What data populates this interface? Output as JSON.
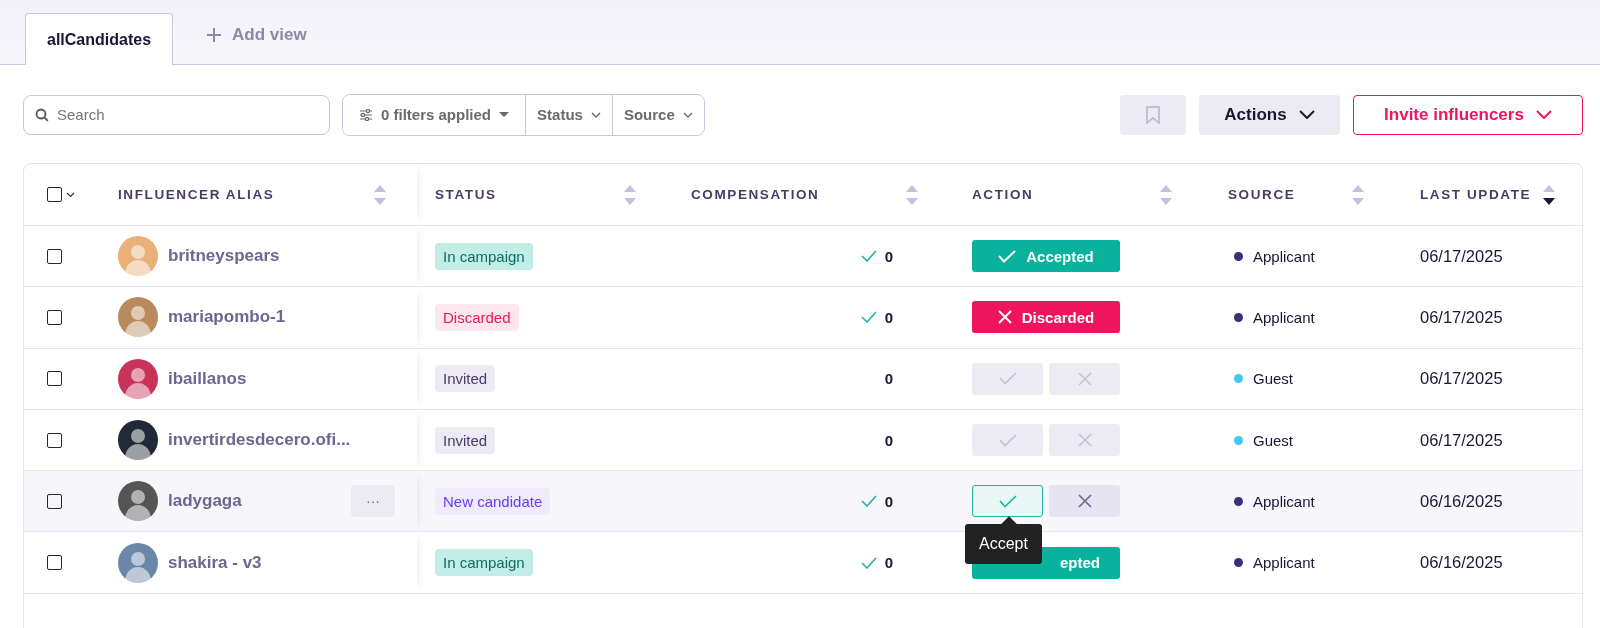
{
  "tabs": [
    {
      "label": "allCandidates",
      "selected": true
    },
    {
      "label": "Add view",
      "selected": false,
      "kind": "add"
    }
  ],
  "toolbar": {
    "search": {
      "placeholder": "Search"
    },
    "filters": {
      "label": "0 filters applied"
    },
    "dropdowns": [
      "Status",
      "Source"
    ],
    "actions": "Actions",
    "invite": "Invite influencers"
  },
  "table": {
    "select_all": {
      "checked": false
    },
    "columns": [
      {
        "label": "INFLUENCER ALIAS",
        "sorted": false
      },
      {
        "label": "STATUS",
        "sorted": false
      },
      {
        "label": "COMPENSATION",
        "sorted": false
      },
      {
        "label": "ACTION",
        "sorted": false
      },
      {
        "label": "SOURCE",
        "sorted": false
      },
      {
        "label": "LAST UPDATE",
        "sorted": true
      }
    ],
    "rows": [
      {
        "alias": "britneyspears",
        "checked": false,
        "hovered": false,
        "status": {
          "label": "In campaign",
          "kind": "campaign"
        },
        "compensation": {
          "value": "0",
          "checked": true
        },
        "action": {
          "kind": "accepted",
          "label": "Accepted"
        },
        "source": {
          "label": "Applicant",
          "color": "#3b2f7a"
        },
        "last_update": "06/17/2025"
      },
      {
        "alias": "mariapombo-1",
        "checked": false,
        "hovered": false,
        "status": {
          "label": "Discarded",
          "kind": "discarded"
        },
        "compensation": {
          "value": "0",
          "checked": true
        },
        "action": {
          "kind": "discarded",
          "label": "Discarded"
        },
        "source": {
          "label": "Applicant",
          "color": "#3b2f7a"
        },
        "last_update": "06/17/2025"
      },
      {
        "alias": "ibaillanos",
        "checked": false,
        "hovered": false,
        "status": {
          "label": "Invited",
          "kind": "invited"
        },
        "compensation": {
          "value": "0",
          "checked": false
        },
        "action": {
          "kind": "pending"
        },
        "source": {
          "label": "Guest",
          "color": "#3ec8f5"
        },
        "last_update": "06/17/2025"
      },
      {
        "alias": "invertirdesdecero.ofi...",
        "checked": false,
        "hovered": false,
        "status": {
          "label": "Invited",
          "kind": "invited"
        },
        "compensation": {
          "value": "0",
          "checked": false
        },
        "action": {
          "kind": "pending"
        },
        "source": {
          "label": "Guest",
          "color": "#3ec8f5"
        },
        "last_update": "06/17/2025"
      },
      {
        "alias": "ladygaga",
        "checked": false,
        "hovered": true,
        "more": "···",
        "tooltip": "Accept",
        "status": {
          "label": "New candidate",
          "kind": "new"
        },
        "compensation": {
          "value": "0",
          "checked": true
        },
        "action": {
          "kind": "pending"
        },
        "source": {
          "label": "Applicant",
          "color": "#3b2f7a"
        },
        "last_update": "06/16/2025"
      },
      {
        "alias": "shakira - v3",
        "checked": false,
        "hovered": false,
        "status": {
          "label": "In campaign",
          "kind": "campaign"
        },
        "compensation": {
          "value": "0",
          "checked": true
        },
        "action": {
          "kind": "accepted",
          "label": "epted"
        },
        "source": {
          "label": "Applicant",
          "color": "#3b2f7a"
        },
        "last_update": "06/16/2025"
      }
    ]
  }
}
